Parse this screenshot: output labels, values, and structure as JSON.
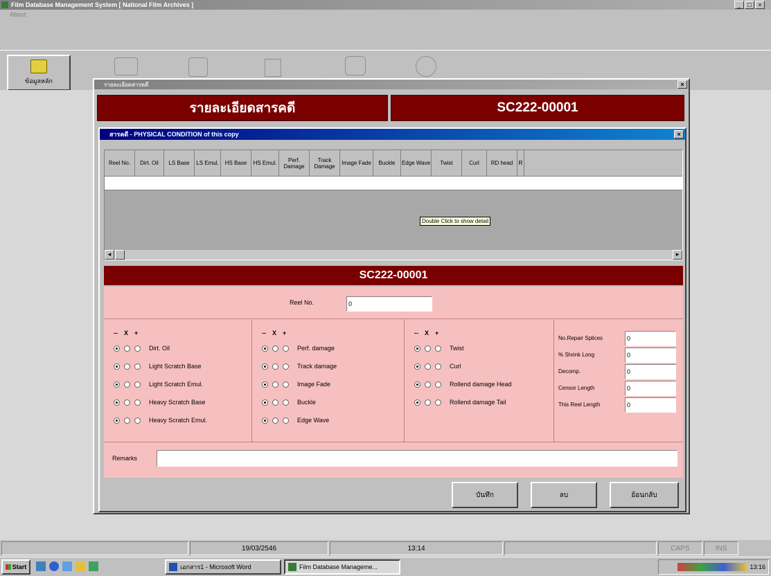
{
  "app": {
    "title": "Film Database Management System  [ National Film Archives ]",
    "menu_about": "About",
    "toolbar": {
      "first_label": "ข้อมูลหลัก"
    }
  },
  "main_window": {
    "title": "รายละเอียดสารคดี",
    "header_left": "รายละเอียดสารคดี",
    "header_right": "SC222-00001"
  },
  "dialog": {
    "title": "สารคดี - PHYSICAL CONDITION of this copy",
    "grid_columns": [
      "Reel No.",
      "Dirt. Oil",
      "LS Base",
      "LS Emul.",
      "HS Base",
      "HS Emul.",
      "Perf. Damage",
      "Track Damage",
      "Image Fade",
      "Buckle",
      "Edge Wave",
      "Twist",
      "Curl",
      "RD head",
      "R"
    ],
    "tooltip": "Double Click to show detail",
    "section_title": "SC222-00001",
    "reel_label": "Reel No.",
    "reel_value": "0",
    "col_header": {
      "a": "--",
      "b": "X",
      "c": "+"
    },
    "group1": [
      "Dirt. Oil",
      "Light Scratch Base",
      "Light Scratch Emul.",
      "Heavy Scratch Base",
      "Heavy Scratch Emul."
    ],
    "group2": [
      "Perf. damage",
      "Track damage",
      "Image Fade",
      "Buckle",
      "Edge Wave"
    ],
    "group3": [
      "Twist",
      "Curl",
      "Rollend damage Head",
      "Rollend damage Tail"
    ],
    "fields": [
      {
        "label": "No.Repair Splices",
        "value": "0"
      },
      {
        "label": "% Shrink Long",
        "value": "0"
      },
      {
        "label": "Decomp.",
        "value": "0"
      },
      {
        "label": "Censor Length",
        "value": "0"
      },
      {
        "label": "This Reel Length",
        "value": "0"
      }
    ],
    "remarks_label": "Remarks",
    "remarks_value": "",
    "buttons": {
      "save": "บันทึก",
      "delete": "ลบ",
      "back": "ย้อนกลับ"
    }
  },
  "statusbar": {
    "date": "19/03/2546",
    "time": "13:14",
    "caps": "CAPS",
    "ins": "INS"
  },
  "taskbar": {
    "start": "Start",
    "task1": "เอกสาร1 - Microsoft Word",
    "task2": "Film Database Manageme...",
    "clock": "13:16"
  },
  "colors": {
    "maroon": "#7a0000",
    "pink": "#f7c0c0",
    "titlebar": "#000080"
  }
}
